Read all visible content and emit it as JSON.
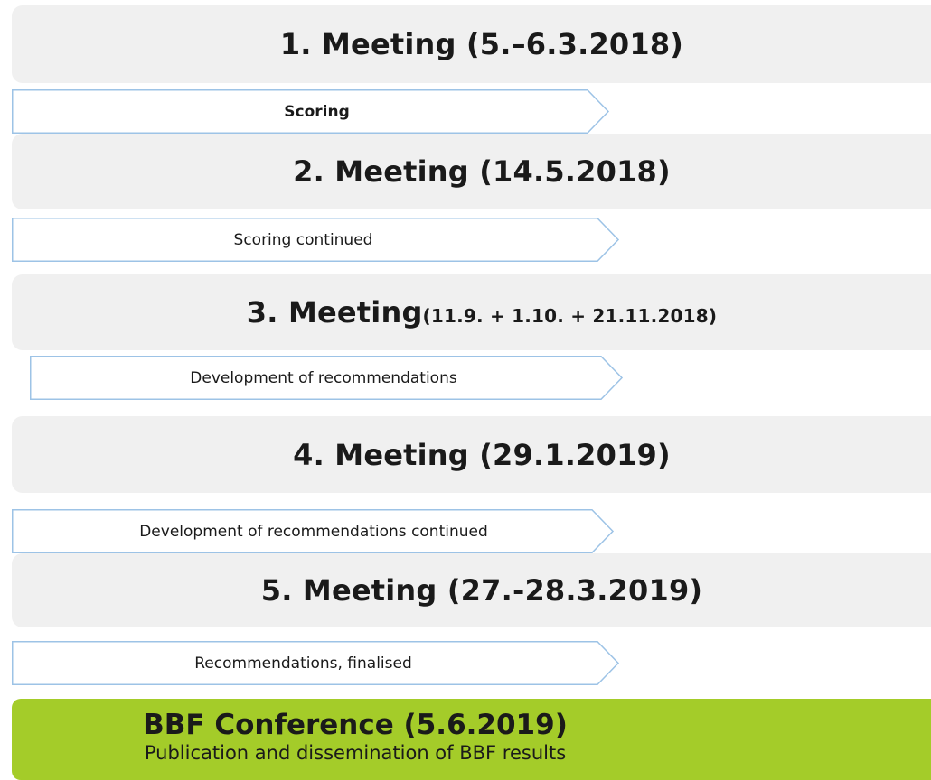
{
  "meetings": [
    {
      "title": "1. Meeting (5.–6.3.2018)",
      "suffix": ""
    },
    {
      "title": "2. Meeting (14.5.2018)",
      "suffix": ""
    },
    {
      "title": "3. Meeting",
      "suffix": "(11.9. + 1.10. + 21.11.2018)"
    },
    {
      "title": "4. Meeting (29.1.2019)",
      "suffix": ""
    },
    {
      "title": "5. Meeting (27.-28.3.2019)",
      "suffix": ""
    }
  ],
  "steps": [
    {
      "label": "Scoring"
    },
    {
      "label": "Scoring continued"
    },
    {
      "label": "Development of recommendations"
    },
    {
      "label": "Development of recommendations continued"
    },
    {
      "label": "Recommendations, finalised"
    }
  ],
  "conference": {
    "title": "BBF Conference (5.6.2019)",
    "description": "Publication and dissemination of BBF results"
  },
  "colors": {
    "meeting_box": "#f0f0f0",
    "arrow_border": "#9dc3e6",
    "conference": "#a4cc29"
  }
}
